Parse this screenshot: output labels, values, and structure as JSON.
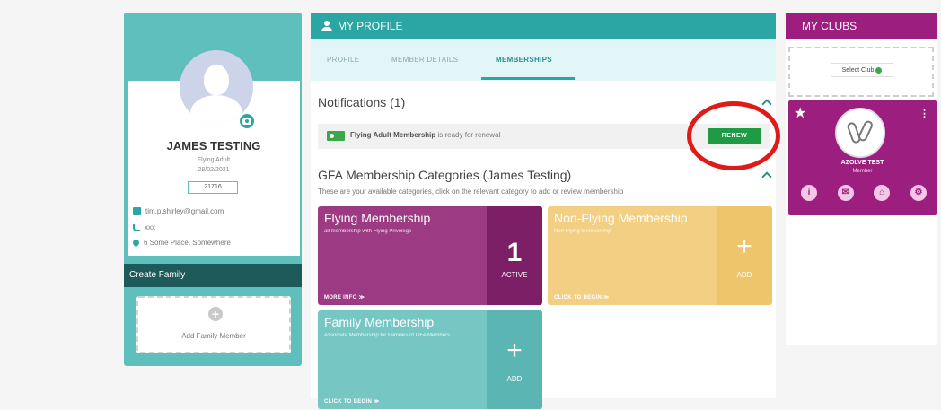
{
  "profile": {
    "name": "JAMES TESTING",
    "membership_type": "Flying Adult",
    "date": "28/02/2021",
    "member_number": "21716",
    "email": "tim.p.shirley@gmail.com",
    "phone": "xxx",
    "address": "6 Some Place, Somewhere",
    "create_family_label": "Create Family",
    "add_family_member_label": "Add Family Member"
  },
  "main": {
    "header_title": "MY PROFILE",
    "tabs": [
      {
        "label": "PROFILE"
      },
      {
        "label": "MEMBER DETAILS"
      },
      {
        "label": "MEMBERSHIPS"
      }
    ],
    "notifications_title": "Notifications (1)",
    "notification": {
      "bold": "Flying Adult Membership",
      "rest": " is ready for renewal",
      "button": "RENEW"
    },
    "categories_title": "GFA Membership Categories (James Testing)",
    "categories_subtitle": "These are your available categories, click on the relevant category to add or review membership",
    "tiles": [
      {
        "title": "Flying Membership",
        "subtitle": "all membership with Flying Privelege",
        "footer": "MORE INFO ≫",
        "side_big": "1",
        "side_label": "ACTIVE"
      },
      {
        "title": "Non-Flying Membership",
        "subtitle": "Non Flying Membership",
        "footer": "CLICK TO BEGIN ≫",
        "side_big": "+",
        "side_label": "ADD"
      },
      {
        "title": "Family Membership",
        "subtitle": "Associate Membership for Families of GFA Members",
        "footer": "CLICK TO BEGIN ≫",
        "side_big": "+",
        "side_label": "ADD"
      }
    ]
  },
  "clubs": {
    "header_title": "MY CLUBS",
    "select_label": "Select Club",
    "club_name": "AZOLVE TEST",
    "club_role": "Member",
    "icons": [
      "i",
      "✉",
      "⌂",
      "⚙"
    ]
  },
  "colors": {
    "teal": "#2ba6a4",
    "purple": "#9c1f7f",
    "renew_green": "#1f9b45",
    "highlight_red": "#e01919"
  }
}
